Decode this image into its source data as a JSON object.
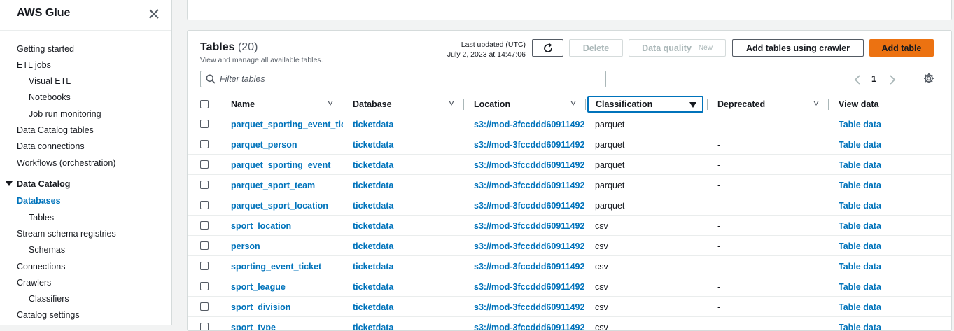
{
  "sidebar": {
    "title": "AWS Glue",
    "items": [
      {
        "label": "Getting started"
      },
      {
        "label": "ETL jobs"
      },
      {
        "label": "Visual ETL"
      },
      {
        "label": "Notebooks"
      },
      {
        "label": "Job run monitoring"
      },
      {
        "label": "Data Catalog tables"
      },
      {
        "label": "Data connections"
      },
      {
        "label": "Workflows (orchestration)"
      },
      {
        "label": "Data Catalog"
      },
      {
        "label": "Databases"
      },
      {
        "label": "Tables"
      },
      {
        "label": "Stream schema registries"
      },
      {
        "label": "Schemas"
      },
      {
        "label": "Connections"
      },
      {
        "label": "Crawlers"
      },
      {
        "label": "Classifiers"
      },
      {
        "label": "Catalog settings"
      }
    ]
  },
  "tables_panel": {
    "title": "Tables",
    "count": "(20)",
    "description": "View and manage all available tables.",
    "last_updated_label": "Last updated (UTC)",
    "last_updated_value": "July 2, 2023 at 14:47:06",
    "buttons": {
      "delete": "Delete",
      "data_quality": "Data quality",
      "data_quality_tag": "New",
      "add_crawler": "Add tables using crawler",
      "add_table": "Add table"
    },
    "filter_placeholder": "Filter tables",
    "page": "1",
    "columns": [
      "Name",
      "Database",
      "Location",
      "Classification",
      "Deprecated",
      "View data"
    ],
    "rows": [
      {
        "name": "parquet_sporting_event_ticket",
        "database": "ticketdata",
        "location": "s3://mod-3fccddd60911492",
        "classification": "parquet",
        "deprecated": "-",
        "view": "Table data"
      },
      {
        "name": "parquet_person",
        "database": "ticketdata",
        "location": "s3://mod-3fccddd60911492",
        "classification": "parquet",
        "deprecated": "-",
        "view": "Table data"
      },
      {
        "name": "parquet_sporting_event",
        "database": "ticketdata",
        "location": "s3://mod-3fccddd60911492",
        "classification": "parquet",
        "deprecated": "-",
        "view": "Table data"
      },
      {
        "name": "parquet_sport_team",
        "database": "ticketdata",
        "location": "s3://mod-3fccddd60911492",
        "classification": "parquet",
        "deprecated": "-",
        "view": "Table data"
      },
      {
        "name": "parquet_sport_location",
        "database": "ticketdata",
        "location": "s3://mod-3fccddd60911492",
        "classification": "parquet",
        "deprecated": "-",
        "view": "Table data"
      },
      {
        "name": "sport_location",
        "database": "ticketdata",
        "location": "s3://mod-3fccddd60911492",
        "classification": "csv",
        "deprecated": "-",
        "view": "Table data"
      },
      {
        "name": "person",
        "database": "ticketdata",
        "location": "s3://mod-3fccddd60911492",
        "classification": "csv",
        "deprecated": "-",
        "view": "Table data"
      },
      {
        "name": "sporting_event_ticket",
        "database": "ticketdata",
        "location": "s3://mod-3fccddd60911492",
        "classification": "csv",
        "deprecated": "-",
        "view": "Table data"
      },
      {
        "name": "sport_league",
        "database": "ticketdata",
        "location": "s3://mod-3fccddd60911492",
        "classification": "csv",
        "deprecated": "-",
        "view": "Table data"
      },
      {
        "name": "sport_division",
        "database": "ticketdata",
        "location": "s3://mod-3fccddd60911492",
        "classification": "csv",
        "deprecated": "-",
        "view": "Table data"
      },
      {
        "name": "sport_type",
        "database": "ticketdata",
        "location": "s3://mod-3fccddd60911492",
        "classification": "csv",
        "deprecated": "-",
        "view": "Table data"
      }
    ]
  },
  "colors": {
    "accent": "#0073bb",
    "primary_button": "#ec7211",
    "text": "#16191f"
  }
}
